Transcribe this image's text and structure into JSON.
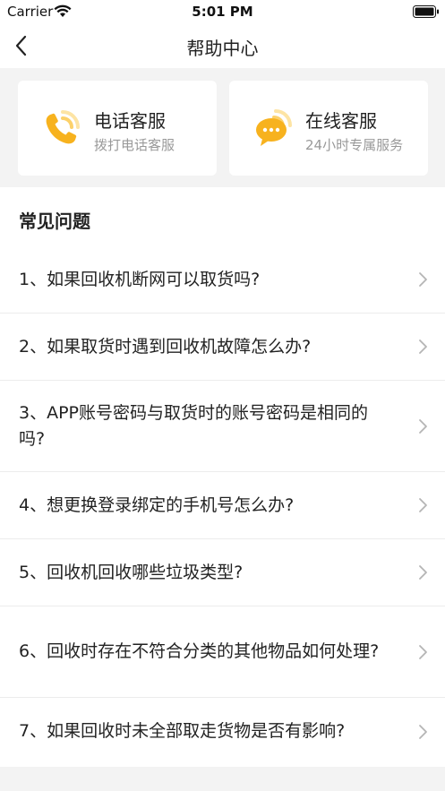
{
  "status": {
    "carrier": "Carrier",
    "time": "5:01 PM"
  },
  "nav": {
    "title": "帮助中心"
  },
  "services": [
    {
      "title": "电话客服",
      "subtitle": "拨打电话客服",
      "icon": "phone-icon"
    },
    {
      "title": "在线客服",
      "subtitle": "24小时专属服务",
      "icon": "chat-bubble-icon"
    }
  ],
  "faq": {
    "title": "常见问题",
    "items": [
      {
        "q": "1、如果回收机断网可以取货吗?"
      },
      {
        "q": "2、如果取货时遇到回收机故障怎么办?"
      },
      {
        "q": "3、APP账号密码与取货时的账号密码是相同的吗?"
      },
      {
        "q": "4、想更换登录绑定的手机号怎么办?"
      },
      {
        "q": "5、回收机回收哪些垃圾类型?"
      },
      {
        "q": "6、回收时存在不符合分类的其他物品如何处理?"
      },
      {
        "q": "7、如果回收时未全部取走货物是否有影响?"
      }
    ]
  },
  "colors": {
    "accent": "#f7b21e",
    "background": "#f3f3f3",
    "text": "#222222",
    "subtext": "#999999"
  }
}
